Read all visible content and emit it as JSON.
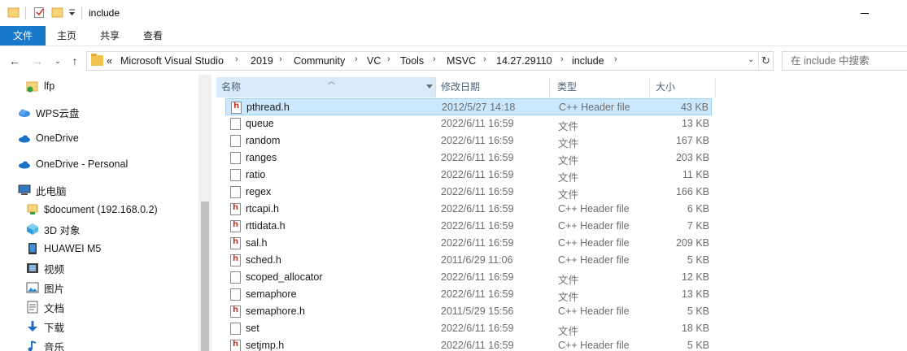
{
  "window": {
    "title": "include"
  },
  "ribbon": {
    "tabs": [
      "文件",
      "主页",
      "共享",
      "查看"
    ]
  },
  "address": {
    "overflow": "«",
    "crumbs": [
      "Microsoft Visual Studio",
      "2019",
      "Community",
      "VC",
      "Tools",
      "MSVC",
      "14.27.29110",
      "include"
    ]
  },
  "search": {
    "placeholder": "在 include 中搜索"
  },
  "sidebar": {
    "items": [
      {
        "label": "lfp",
        "icon": "folder-check-icon"
      },
      {
        "label": "WPS云盘",
        "icon": "wps-cloud-icon"
      },
      {
        "label": "OneDrive",
        "icon": "onedrive-icon"
      },
      {
        "label": "OneDrive - Personal",
        "icon": "onedrive-icon"
      },
      {
        "label": "此电脑",
        "icon": "this-pc-icon"
      },
      {
        "label": "$document (192.168.0.2)",
        "icon": "network-drive-icon"
      },
      {
        "label": "3D 对象",
        "icon": "3d-objects-icon"
      },
      {
        "label": "HUAWEI M5",
        "icon": "tablet-icon"
      },
      {
        "label": "视频",
        "icon": "video-icon"
      },
      {
        "label": "图片",
        "icon": "pictures-icon"
      },
      {
        "label": "文档",
        "icon": "documents-icon"
      },
      {
        "label": "下载",
        "icon": "download-icon"
      },
      {
        "label": "音乐",
        "icon": "music-icon"
      }
    ]
  },
  "columns": {
    "name": "名称",
    "date": "修改日期",
    "type": "类型",
    "size": "大小"
  },
  "files": [
    {
      "name": "pthread.h",
      "date": "2012/5/27 14:18",
      "type": "C++ Header file",
      "size": "43 KB",
      "icon": "header-file-icon",
      "selected": true
    },
    {
      "name": "queue",
      "date": "2022/6/11 16:59",
      "type": "文件",
      "size": "13 KB",
      "icon": "file-icon"
    },
    {
      "name": "random",
      "date": "2022/6/11 16:59",
      "type": "文件",
      "size": "167 KB",
      "icon": "file-icon"
    },
    {
      "name": "ranges",
      "date": "2022/6/11 16:59",
      "type": "文件",
      "size": "203 KB",
      "icon": "file-icon"
    },
    {
      "name": "ratio",
      "date": "2022/6/11 16:59",
      "type": "文件",
      "size": "11 KB",
      "icon": "file-icon"
    },
    {
      "name": "regex",
      "date": "2022/6/11 16:59",
      "type": "文件",
      "size": "166 KB",
      "icon": "file-icon"
    },
    {
      "name": "rtcapi.h",
      "date": "2022/6/11 16:59",
      "type": "C++ Header file",
      "size": "6 KB",
      "icon": "header-file-icon"
    },
    {
      "name": "rttidata.h",
      "date": "2022/6/11 16:59",
      "type": "C++ Header file",
      "size": "7 KB",
      "icon": "header-file-icon"
    },
    {
      "name": "sal.h",
      "date": "2022/6/11 16:59",
      "type": "C++ Header file",
      "size": "209 KB",
      "icon": "header-file-icon"
    },
    {
      "name": "sched.h",
      "date": "2011/6/29 11:06",
      "type": "C++ Header file",
      "size": "5 KB",
      "icon": "header-file-icon"
    },
    {
      "name": "scoped_allocator",
      "date": "2022/6/11 16:59",
      "type": "文件",
      "size": "12 KB",
      "icon": "file-icon"
    },
    {
      "name": "semaphore",
      "date": "2022/6/11 16:59",
      "type": "文件",
      "size": "13 KB",
      "icon": "file-icon"
    },
    {
      "name": "semaphore.h",
      "date": "2011/5/29 15:56",
      "type": "C++ Header file",
      "size": "5 KB",
      "icon": "header-file-icon"
    },
    {
      "name": "set",
      "date": "2022/6/11 16:59",
      "type": "文件",
      "size": "18 KB",
      "icon": "file-icon"
    },
    {
      "name": "setjmp.h",
      "date": "2022/6/11 16:59",
      "type": "C++ Header file",
      "size": "5 KB",
      "icon": "header-file-icon"
    }
  ],
  "colors": {
    "file_tab": "#1979ca",
    "selection": "#cce8ff",
    "header_active": "#d9ebf9"
  }
}
